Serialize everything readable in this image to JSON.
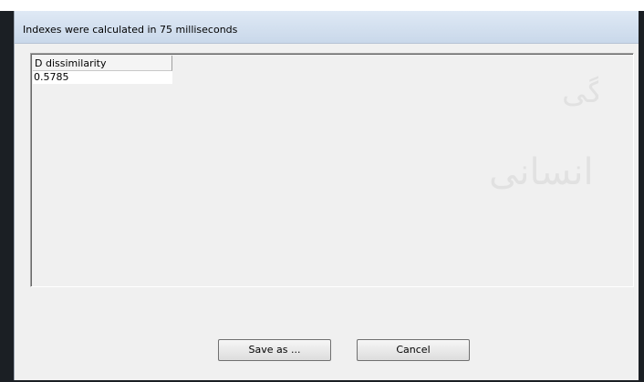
{
  "dialog": {
    "title": "Indexes were calculated in 75 milliseconds"
  },
  "grid": {
    "columns": [
      "D dissimilarity"
    ],
    "rows": [
      [
        "0.5785"
      ]
    ]
  },
  "buttons": {
    "save_label": "Save as ...",
    "cancel_label": "Cancel"
  },
  "watermark": {
    "line1": "پژوهشگاه علوم انسانی و مطالعات فرهنگی",
    "line2": "پرتال جامع علوم انسانی"
  },
  "colors": {
    "titlebar": "#c9d8ea",
    "dialog_bg": "#f0f0f0",
    "frame": "#1b1f24"
  }
}
